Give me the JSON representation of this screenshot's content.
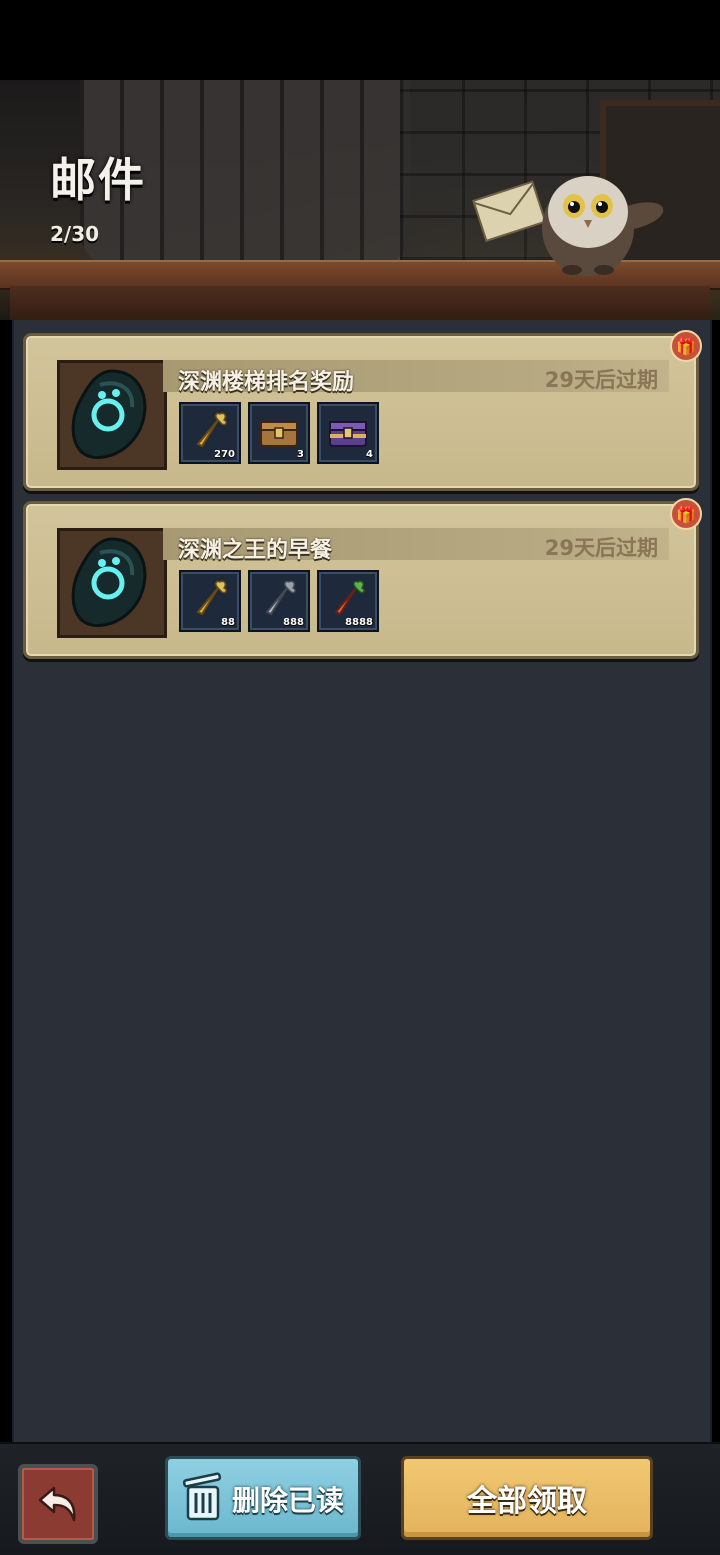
{
  "header": {
    "title": "邮件",
    "count": "2/30"
  },
  "mails": [
    {
      "title": "深渊楼梯排名奖励",
      "expiry": "29天后过期",
      "icon": "abyss-paw-stone-icon",
      "rewards": [
        {
          "icon": "golden-carrot-icon",
          "qty": "270"
        },
        {
          "icon": "wooden-chest-icon",
          "qty": "3"
        },
        {
          "icon": "purple-chest-icon",
          "qty": "4"
        }
      ]
    },
    {
      "title": "深渊之王的早餐",
      "expiry": "29天后过期",
      "icon": "abyss-paw-stone-icon",
      "rewards": [
        {
          "icon": "golden-carrot-icon",
          "qty": "88"
        },
        {
          "icon": "silver-carrot-icon",
          "qty": "888"
        },
        {
          "icon": "orange-carrot-icon",
          "qty": "8888"
        }
      ]
    }
  ],
  "footer": {
    "delete_label": "删除已读",
    "claim_all_label": "全部领取"
  },
  "colors": {
    "panel_bg": "#2b2f37",
    "card_bg": "#cfc197",
    "delete_button": "#7ec4d8",
    "claim_button": "#ebbd68",
    "back_button": "#8b3b31"
  }
}
